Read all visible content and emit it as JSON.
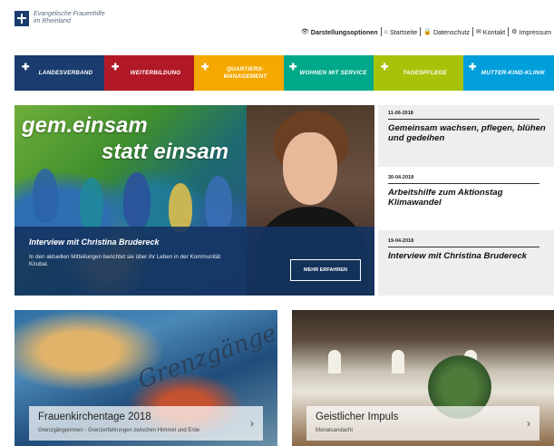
{
  "logo": {
    "line1": "Evangelische Frauenhilfe",
    "line2": "im Rheinland"
  },
  "topnav": {
    "display_options": "Darstellungsoptionen",
    "home": "Startseite",
    "privacy": "Datenschutz",
    "contact": "Kontakt",
    "imprint": "Impressum"
  },
  "mainnav": [
    {
      "label": "Landesverband",
      "color": "#1a3c6e"
    },
    {
      "label": "Weiterbildung",
      "color": "#b21926"
    },
    {
      "label": "Quartiers-\nmanagement",
      "color": "#f5a800"
    },
    {
      "label": "Wohnen mit Service",
      "color": "#00a88a"
    },
    {
      "label": "Tagespflege",
      "color": "#a8c20a"
    },
    {
      "label": "Mutter-Kind-Klinik",
      "color": "#009fdb"
    }
  ],
  "hero": {
    "title_line1": "gem.einsam",
    "title_line2": "statt einsam",
    "panel_title": "Interview mit Christina Brudereck",
    "panel_text": "In den aktuellen Mitteilungen berichtet sie über ihr Leben in der Kommunität Kirubai.",
    "button": "Mehr erfahren"
  },
  "news": [
    {
      "date": "11-06-2018",
      "title": "Gemeinsam wachsen, pflegen, blühen und gedeihen"
    },
    {
      "date": "30-04-2018",
      "title": "Arbeitshilfe zum Aktionstag Klimawandel"
    },
    {
      "date": "19-04-2018",
      "title": "Interview mit Christina Brudereck"
    }
  ],
  "cards": [
    {
      "art_text": "Grenzgängerinnen",
      "title": "Frauenkirchentage 2018",
      "subtitle": "Grenzgängerinnen - Grenzerfahrungen zwischen Himmel und Erde"
    },
    {
      "title": "Geistlicher Impuls",
      "subtitle": "Monatsandacht"
    }
  ]
}
